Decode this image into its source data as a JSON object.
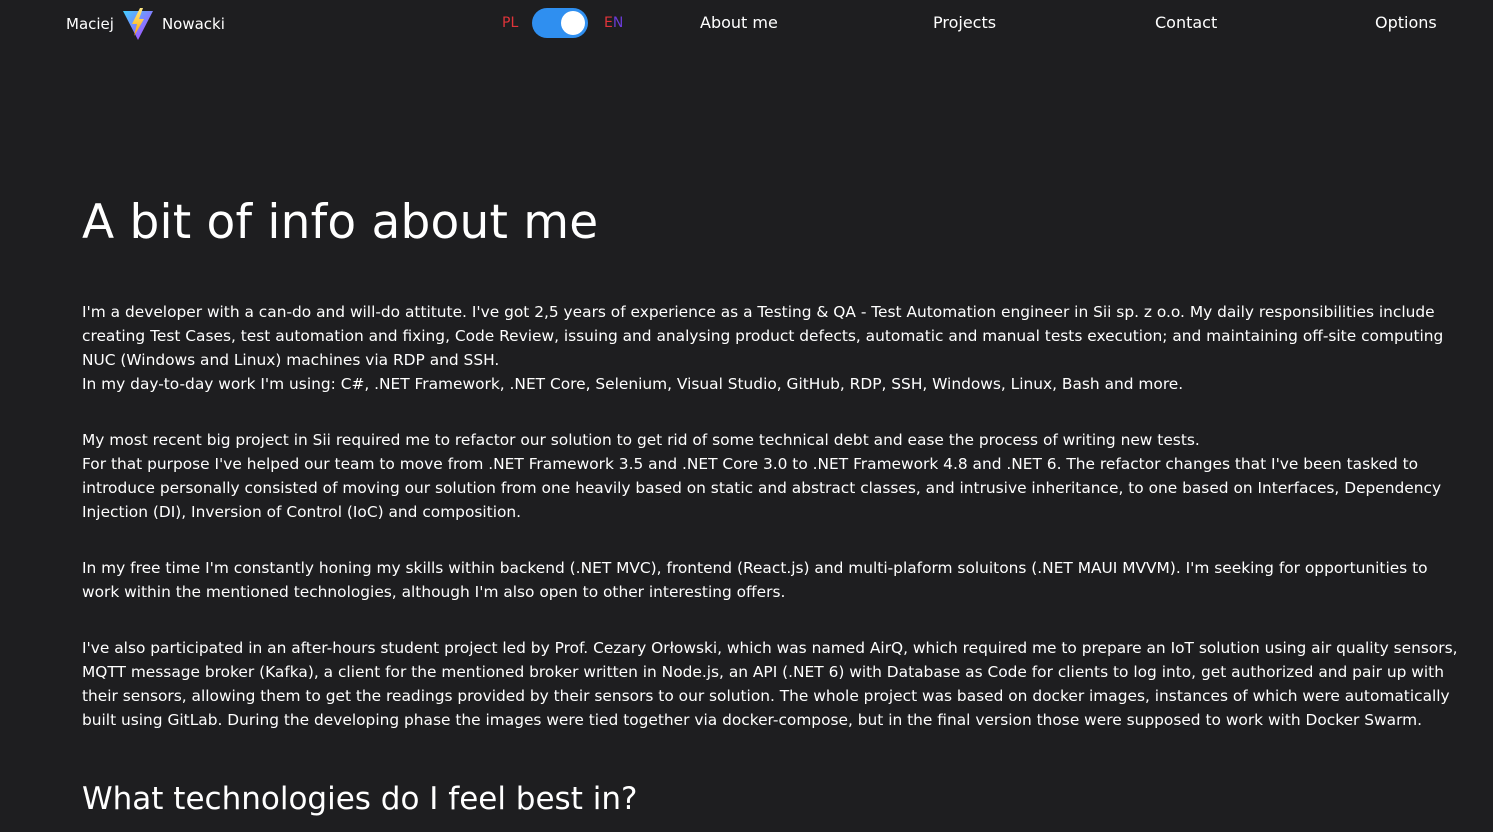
{
  "brand": {
    "first_name": "Maciej",
    "last_name": "Nowacki",
    "logo_icon": "vite-lightning-logo-icon"
  },
  "language": {
    "pl_label": "PL",
    "en_label_e": "E",
    "en_label_n": "N",
    "toggle_state": "EN"
  },
  "nav": {
    "about": "About me",
    "projects": "Projects",
    "contact": "Contact",
    "options": "Options"
  },
  "main": {
    "title": "A bit of info about me",
    "p1_line1": "I'm a developer with a can-do and will-do attitute. I've got 2,5 years of experience as a Testing & QA - Test Automation engineer in Sii sp. z o.o. My daily responsibilities include creating Test Cases, test automation and fixing, Code Review, issuing and analysing product defects, automatic and manual tests execution; and maintaining off-site computing NUC (Windows and Linux) machines via RDP and SSH.",
    "p1_line2": "In my day-to-day work I'm using: C#, .NET Framework, .NET Core, Selenium, Visual Studio, GitHub, RDP, SSH, Windows, Linux, Bash and more.",
    "p2_line1": "My most recent big project in Sii required me to refactor our solution to get rid of some technical debt and ease the process of writing new tests.",
    "p2_line2": "For that purpose I've helped our team to move from .NET Framework 3.5 and .NET Core 3.0 to .NET Framework 4.8 and .NET 6. The refactor changes that I've been tasked to introduce personally consisted of moving our solution from one heavily based on static and abstract classes, and intrusive inheritance, to one based on Interfaces, Dependency Injection (DI), Inversion of Control (IoC) and composition.",
    "p3": "In my free time I'm constantly honing my skills within backend (.NET MVC), frontend (React.js) and multi-plaform soluitons (.NET MAUI MVVM). I'm seeking for opportunities to work within the mentioned technologies, although I'm also open to other interesting offers.",
    "p4": "I've also participated in an after-hours student project led by Prof. Cezary Orłowski, which was named AirQ, which required me to prepare an IoT solution using air quality sensors, MQTT message broker (Kafka), a client for the mentioned broker written in Node.js, an API (.NET 6) with Database as Code for clients to log into, get authorized and pair up with their sensors, allowing them to get the readings provided by their sensors to our solution. The whole project was based on docker images, instances of which were automatically built using GitLab. During the developing phase the images were tied together via docker-compose, but in the final version those were supposed to work with Docker Swarm.",
    "subtitle": "What technologies do I feel best in?"
  },
  "colors": {
    "background": "#1e1e20",
    "toggle_track": "#2f8ff0",
    "pl_color": "#e0343a",
    "en_n_color": "#6a3bd6"
  }
}
